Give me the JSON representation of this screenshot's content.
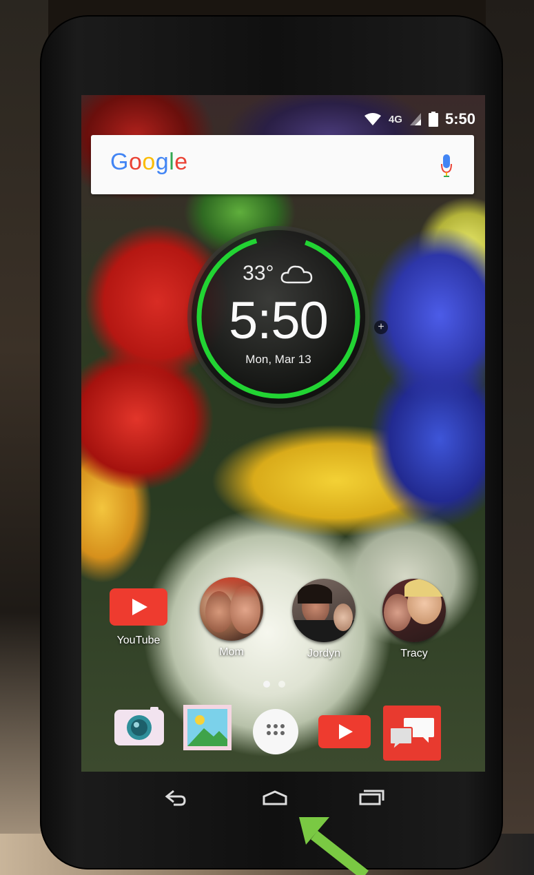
{
  "status_bar": {
    "network": "4G",
    "time": "5:50"
  },
  "search": {
    "logo_text": "Google",
    "logo_colors": [
      "#4285F4",
      "#EA4335",
      "#FBBC05",
      "#4285F4",
      "#34A853",
      "#EA4335"
    ]
  },
  "clock_widget": {
    "temperature": "33°",
    "weather_icon": "cloud-icon",
    "time": "5:50",
    "date": "Mon, Mar 13",
    "ring_color": "#22d433",
    "plus": "+"
  },
  "home_apps": [
    {
      "label": "YouTube",
      "icon": "youtube-icon"
    },
    {
      "label": "Mom",
      "icon": "contact-photo"
    },
    {
      "label": "Jordyn",
      "icon": "contact-photo"
    },
    {
      "label": "Tracy",
      "icon": "contact-photo"
    }
  ],
  "page_indicator": {
    "pages": 2,
    "current": 1
  },
  "dock": [
    {
      "icon": "camera-icon"
    },
    {
      "icon": "gallery-icon"
    },
    {
      "icon": "app-drawer-icon"
    },
    {
      "icon": "youtube-icon"
    },
    {
      "icon": "messages-icon"
    }
  ],
  "nav_bar": {
    "back": "back-icon",
    "home": "home-icon",
    "recents": "recents-icon"
  },
  "annotation": {
    "arrow_color": "#7ac943"
  }
}
